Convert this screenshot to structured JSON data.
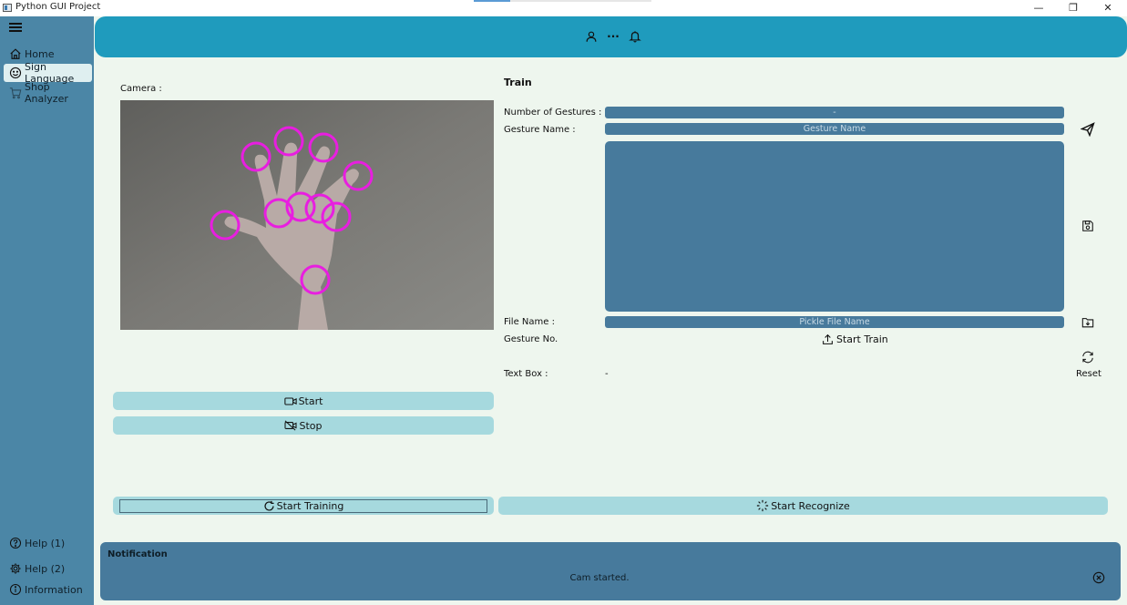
{
  "window": {
    "title": "Python GUI Project",
    "controls": {
      "minimize": "—",
      "maximize": "❐",
      "close": "✕"
    }
  },
  "sidebar": {
    "items": [
      {
        "label": "Home",
        "icon": "home-icon",
        "active": false
      },
      {
        "label": "Sign Language",
        "icon": "smile-icon",
        "active": true
      },
      {
        "label": "Shop Analyzer",
        "icon": "cart-icon",
        "active": false
      }
    ],
    "bottom_items": [
      {
        "label": "Help (1)",
        "icon": "help-circle-icon"
      },
      {
        "label": "Help (2)",
        "icon": "gear-icon"
      },
      {
        "label": "Information",
        "icon": "info-icon"
      }
    ]
  },
  "header": {
    "icons": [
      "user-icon",
      "more-icon",
      "bell-icon"
    ],
    "more_glyph": "···"
  },
  "camera": {
    "label": "Camera :"
  },
  "controls": {
    "start_label": "Start",
    "stop_label": "Stop",
    "start_training_label": "Start Training",
    "start_recognize_label": "Start Recognize"
  },
  "train": {
    "title": "Train",
    "num_gestures_label": "Number of Gestures  :",
    "num_gestures_value": "-",
    "gesture_name_label": "Gesture Name :",
    "gesture_name_placeholder": "Gesture Name",
    "file_name_label": "File Name :",
    "file_name_placeholder": "Pickle File Name",
    "gesture_no_label": "Gesture No.",
    "start_train_label": "Start Train",
    "text_box_label": "Text Box :",
    "text_box_value": "-",
    "reset_label": "Reset"
  },
  "notification": {
    "title": "Notification",
    "message": "Cam started."
  },
  "colors": {
    "sidebar": "#4b86a6",
    "header": "#1f9bbd",
    "field": "#477a9c",
    "button": "#a6d9de",
    "background": "#eef6ee",
    "landmark": "#e81ee0"
  }
}
